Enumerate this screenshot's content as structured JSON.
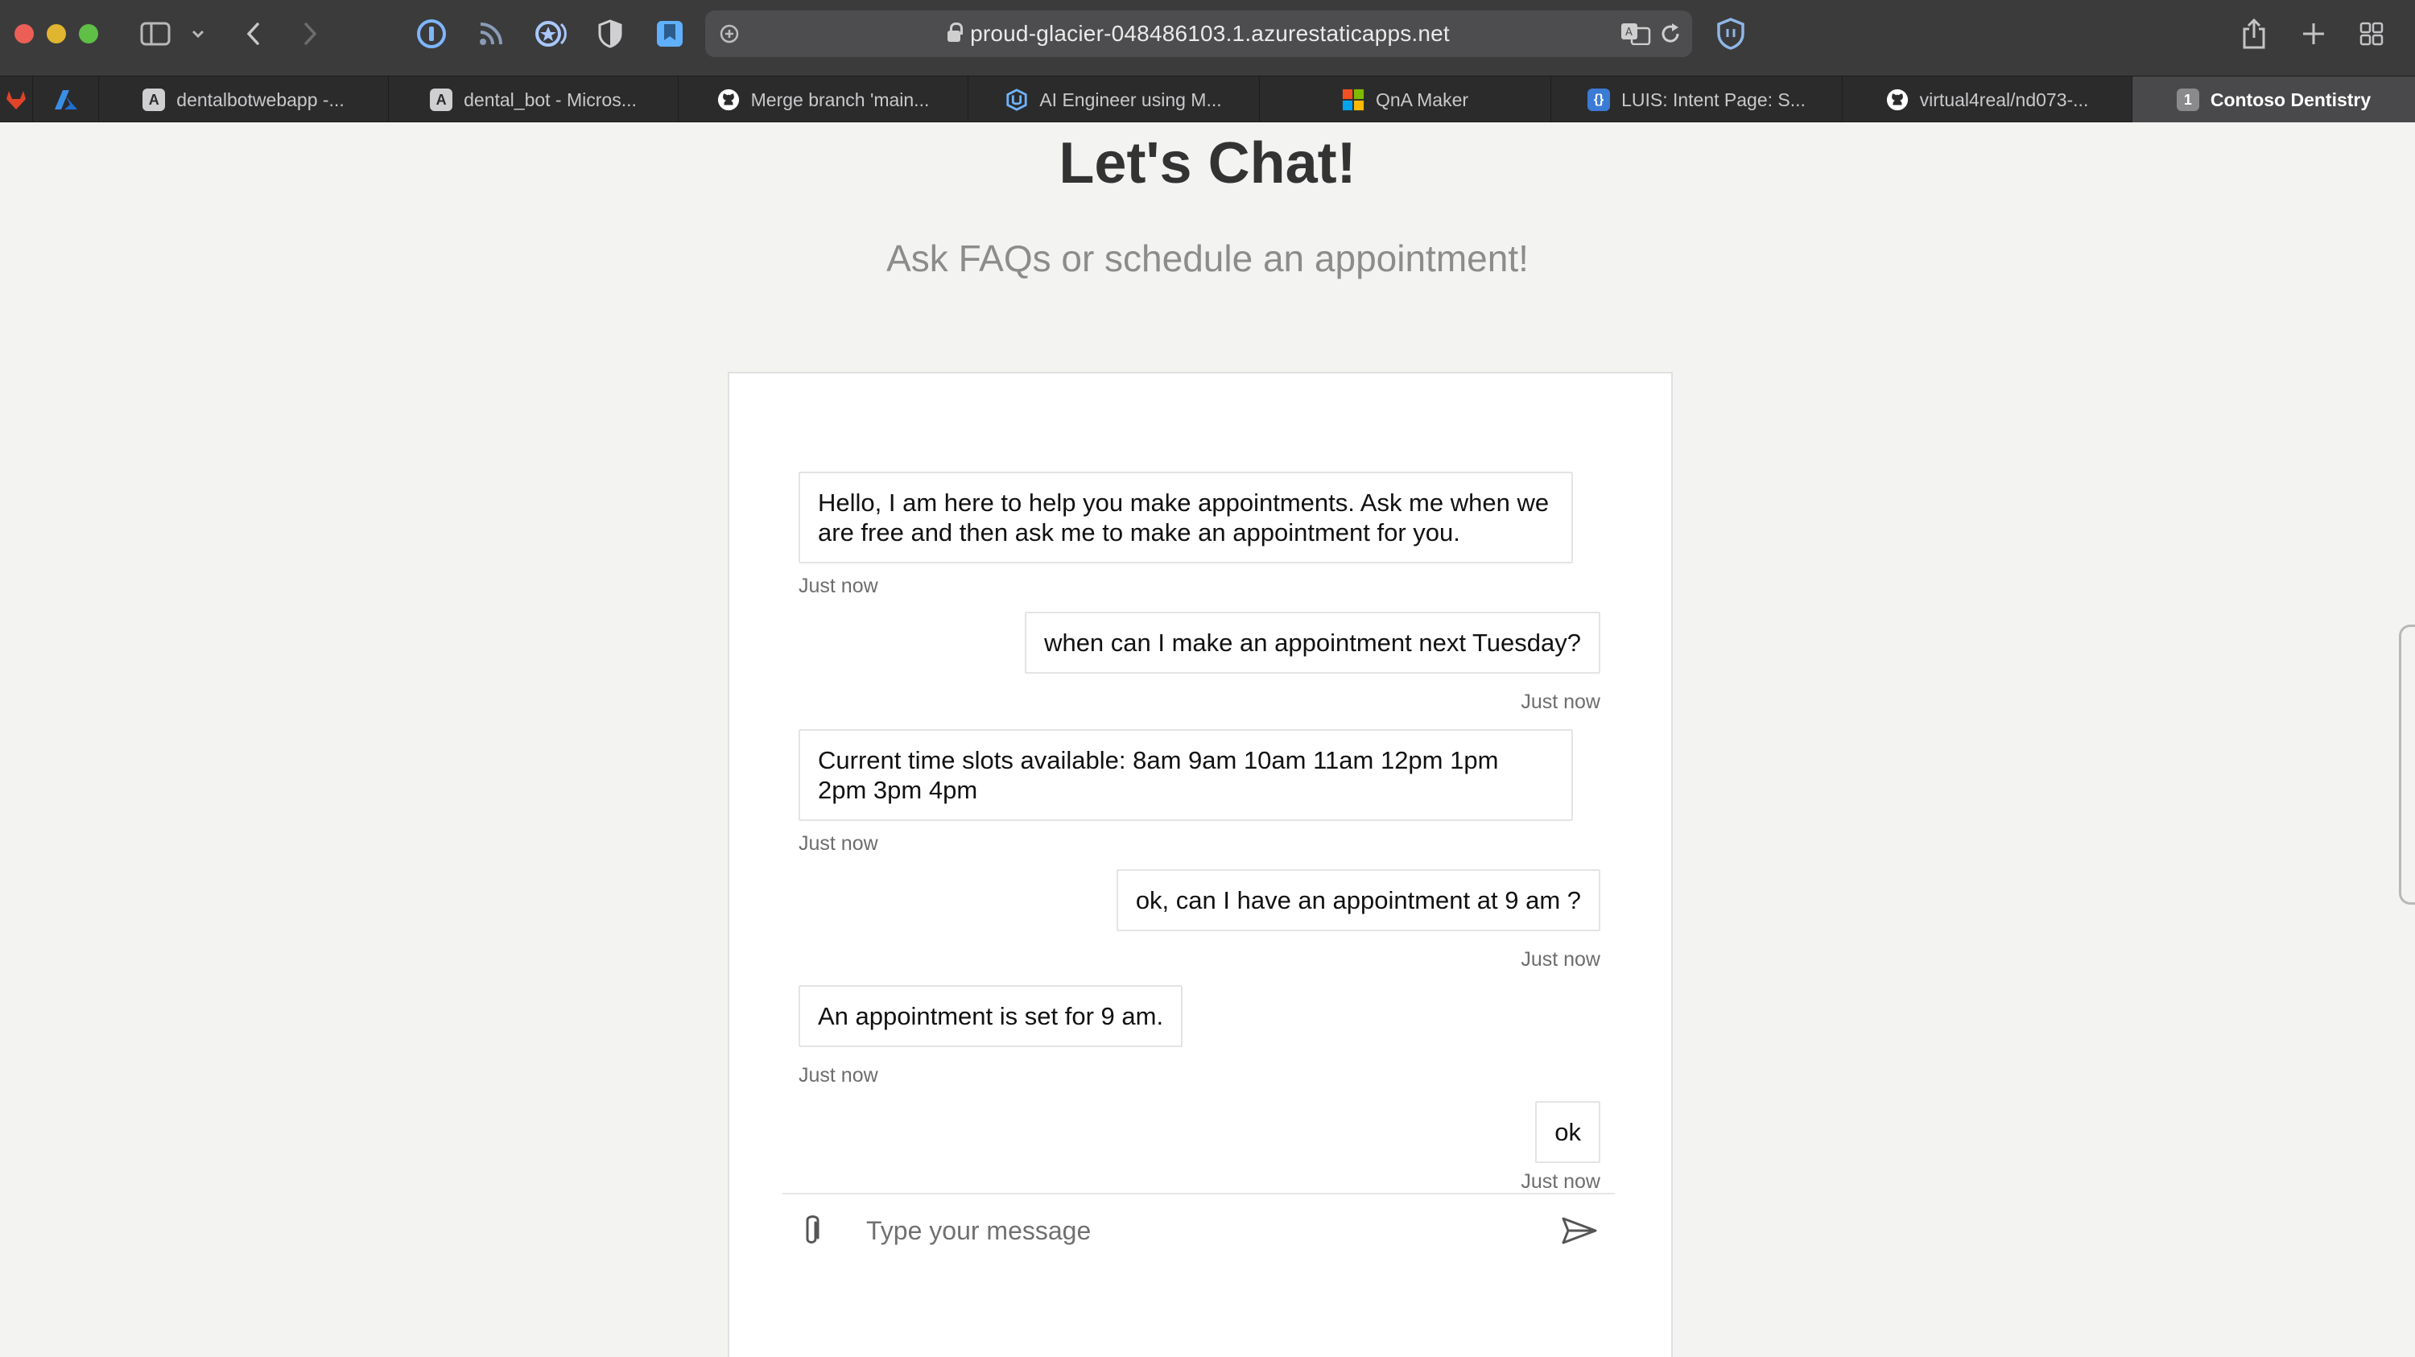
{
  "browser": {
    "url": "proud-glacier-048486103.1.azurestaticapps.net",
    "tabs": [
      {
        "label": "dentalbotwebapp -...",
        "favicon_letter": "A"
      },
      {
        "label": "dental_bot - Micros...",
        "favicon_letter": "A"
      },
      {
        "label": "Merge branch 'main...",
        "favicon": "github-icon"
      },
      {
        "label": "AI Engineer using M...",
        "favicon": "udacity-icon"
      },
      {
        "label": "QnA Maker",
        "favicon": "microsoft-icon"
      },
      {
        "label": "LUIS: Intent Page: S...",
        "favicon": "luis-icon"
      },
      {
        "label": "virtual4real/nd073-...",
        "favicon": "github-icon"
      },
      {
        "label": "Contoso Dentistry",
        "favicon_letter": "1",
        "active": true
      }
    ]
  },
  "page": {
    "heading": "Let's Chat!",
    "subheading": "Ask FAQs or schedule an appointment!"
  },
  "chat": {
    "messages": [
      {
        "from": "bot",
        "text": "Hello, I am here to help you make appointments. Ask me when we are free and then ask me to make an appointment for you.",
        "time": "Just now"
      },
      {
        "from": "user",
        "text": "when can I make an appointment next Tuesday?",
        "time": "Just now"
      },
      {
        "from": "bot",
        "text": "Current time slots available: 8am 9am 10am 11am 12pm 1pm 2pm 3pm 4pm",
        "time": "Just now"
      },
      {
        "from": "user",
        "text": "ok, can I have an appointment at 9 am ?",
        "time": "Just now"
      },
      {
        "from": "bot",
        "text": "An appointment is set for 9 am.",
        "time": "Just now"
      },
      {
        "from": "user",
        "text": "ok",
        "time": "Just now"
      }
    ],
    "input_placeholder": "Type your message"
  },
  "colors": {
    "toolbar": "#3b3b3c",
    "tabbar": "#2b2b2c",
    "active_tab": "#49494b",
    "page_background": "#f3f3f2",
    "chat_background": "#ffffff",
    "heading": "#333333",
    "subheading": "#8c8c8c"
  }
}
